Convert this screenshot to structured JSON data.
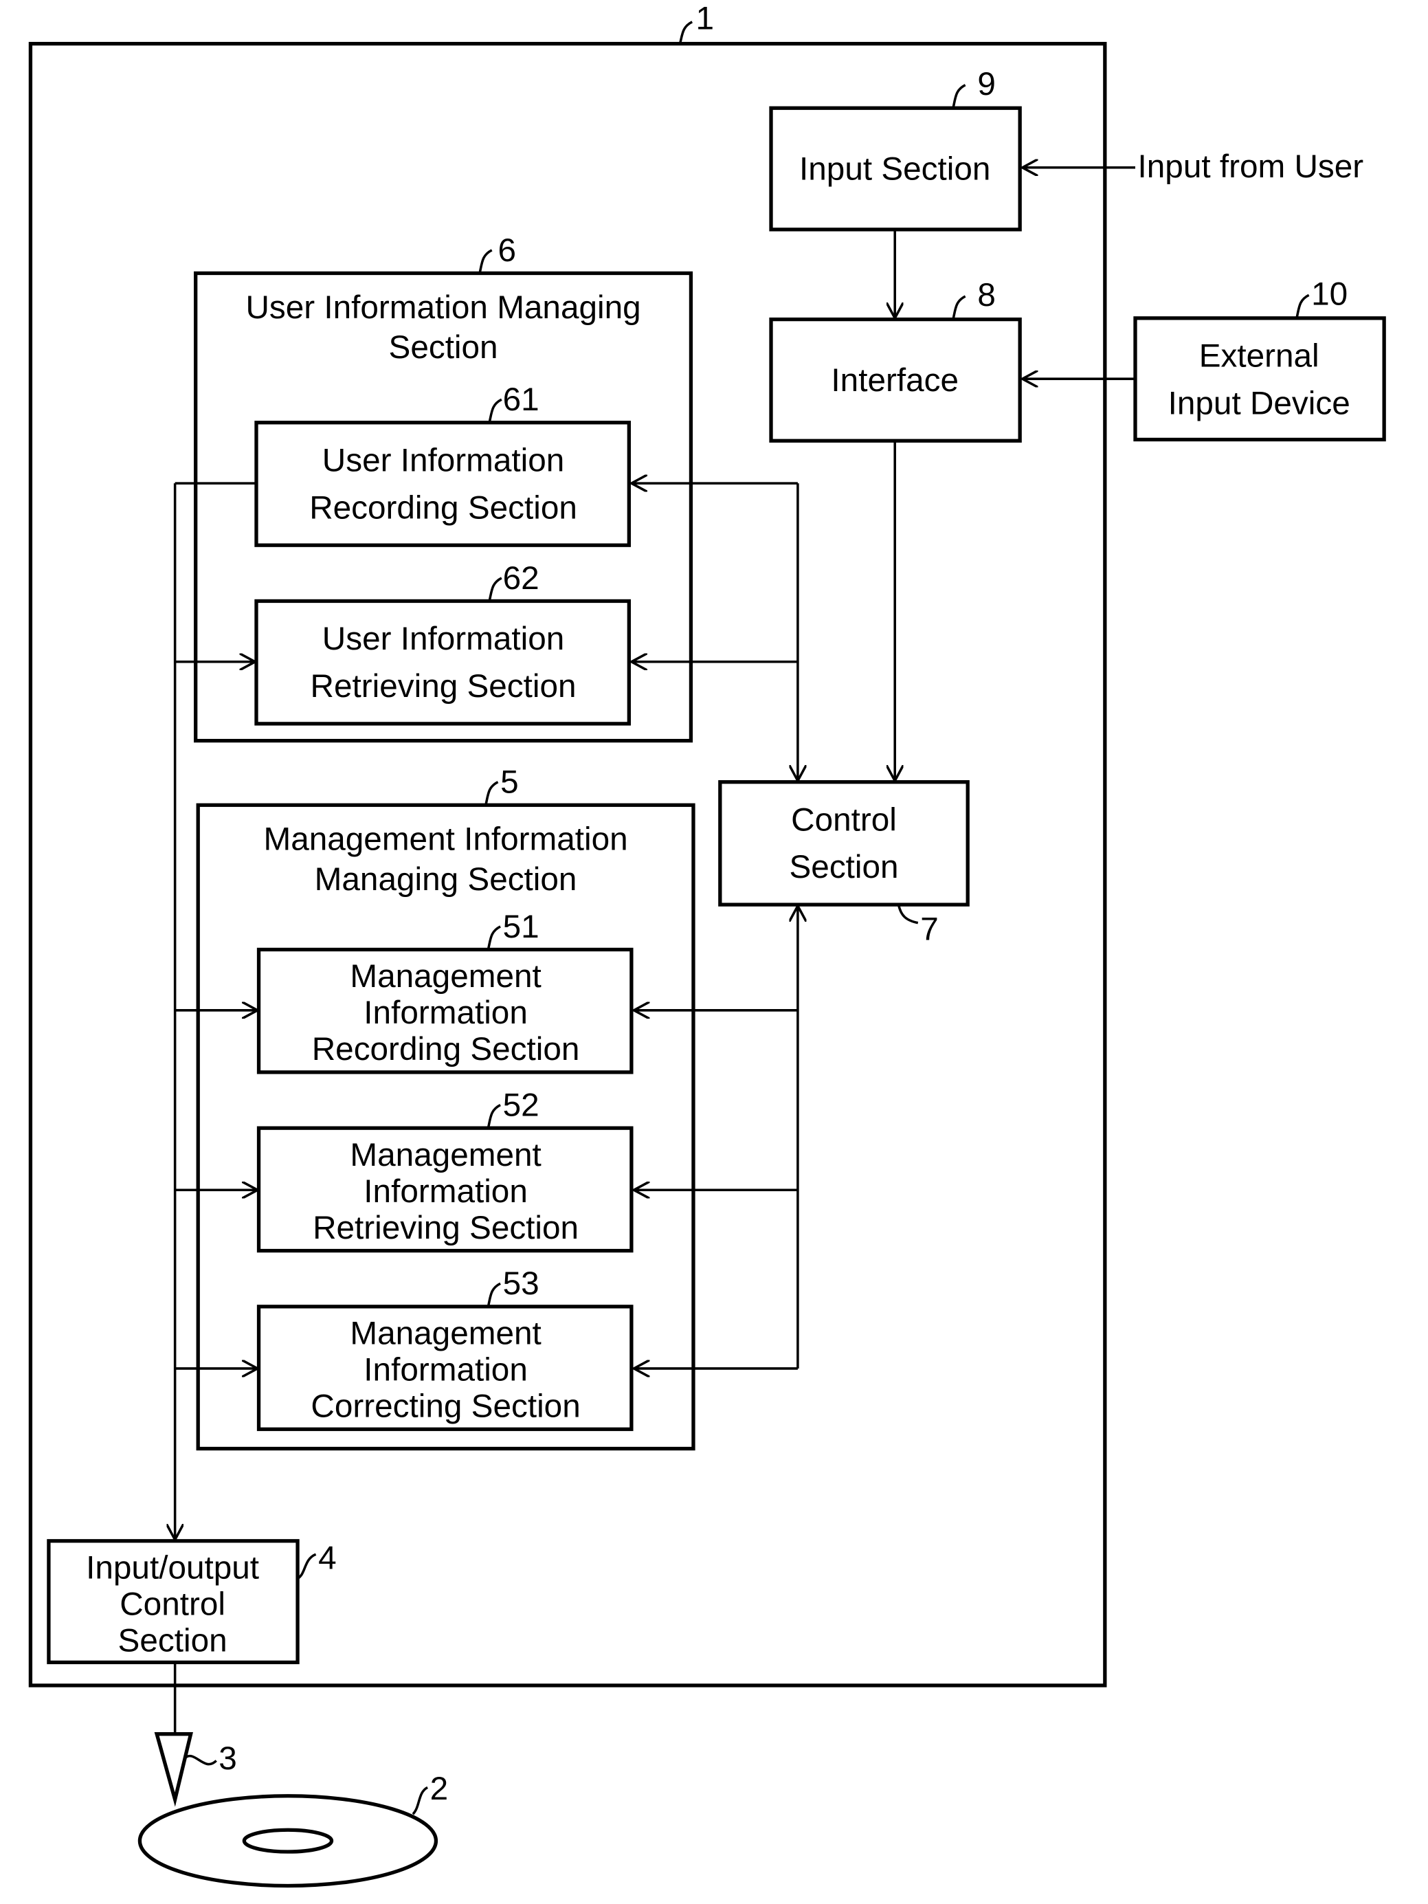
{
  "diagram": {
    "type": "block-diagram",
    "outer_ref": "1",
    "blocks": {
      "input_section": {
        "ref": "9",
        "lines": [
          "Input Section"
        ]
      },
      "interface": {
        "ref": "8",
        "lines": [
          "Interface"
        ]
      },
      "external_input_device": {
        "ref": "10",
        "lines": [
          "External",
          "Input Device"
        ]
      },
      "user_info_managing": {
        "ref": "6",
        "lines": [
          "User Information Managing",
          "Section"
        ]
      },
      "user_info_recording": {
        "ref": "61",
        "lines": [
          "User Information",
          "Recording Section"
        ]
      },
      "user_info_retrieving": {
        "ref": "62",
        "lines": [
          "User Information",
          "Retrieving Section"
        ]
      },
      "mgmt_info_managing": {
        "ref": "5",
        "lines": [
          "Management Information",
          "Managing Section"
        ]
      },
      "mgmt_info_recording": {
        "ref": "51",
        "lines": [
          "Management",
          "Information",
          "Recording Section"
        ]
      },
      "mgmt_info_retrieving": {
        "ref": "52",
        "lines": [
          "Management",
          "Information",
          "Retrieving Section"
        ]
      },
      "mgmt_info_correcting": {
        "ref": "53",
        "lines": [
          "Management",
          "Information",
          "Correcting Section"
        ]
      },
      "control_section": {
        "ref": "7",
        "lines": [
          "Control",
          "Section"
        ]
      },
      "io_control": {
        "ref": "4",
        "lines": [
          "Input/output",
          "Control",
          "Section"
        ]
      }
    },
    "external_input_label": "Input from User",
    "pickup_ref": "3",
    "disc_ref": "2"
  }
}
